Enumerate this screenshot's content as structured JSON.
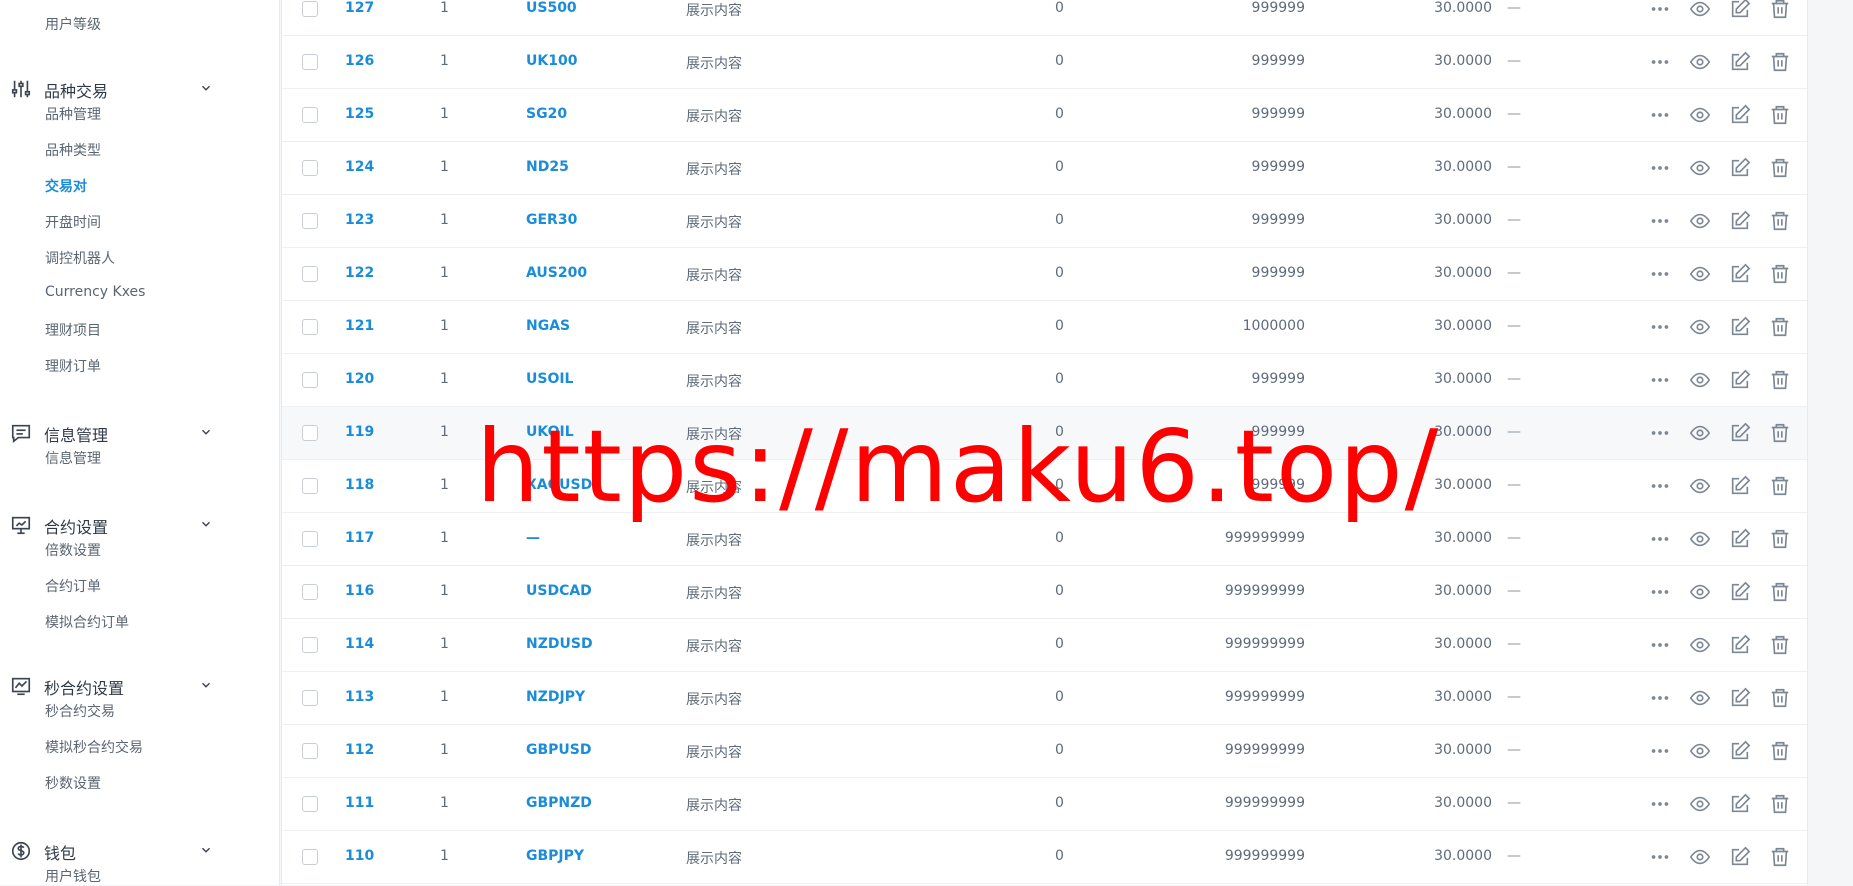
{
  "sidebar": {
    "top_item": "用户等级",
    "groups": [
      {
        "label": "品种交易",
        "icon": "sliders-icon",
        "items": [
          "品种管理",
          "品种类型",
          "交易对",
          "开盘时间",
          "调控机器人",
          "Currency Kxes",
          "理财项目",
          "理财订单"
        ],
        "active_index": 2
      },
      {
        "label": "信息管理",
        "icon": "message-icon",
        "items": [
          "信息管理"
        ]
      },
      {
        "label": "合约设置",
        "icon": "presentation-chart-icon",
        "items": [
          "倍数设置",
          "合约订单",
          "模拟合约订单"
        ]
      },
      {
        "label": "秒合约设置",
        "icon": "trend-chart-icon",
        "items": [
          "秒合约交易",
          "模拟秒合约交易",
          "秒数设置"
        ]
      },
      {
        "label": "钱包",
        "icon": "dollar-icon",
        "items": [
          "用户钱包"
        ]
      }
    ]
  },
  "table": {
    "rows": [
      {
        "id": "127",
        "one": "1",
        "symbol": "US500",
        "desc": "展示内容",
        "zero": "0",
        "max": "999999",
        "price": "30.0000",
        "dash": "—"
      },
      {
        "id": "126",
        "one": "1",
        "symbol": "UK100",
        "desc": "展示内容",
        "zero": "0",
        "max": "999999",
        "price": "30.0000",
        "dash": "—"
      },
      {
        "id": "125",
        "one": "1",
        "symbol": "SG20",
        "desc": "展示内容",
        "zero": "0",
        "max": "999999",
        "price": "30.0000",
        "dash": "—"
      },
      {
        "id": "124",
        "one": "1",
        "symbol": "ND25",
        "desc": "展示内容",
        "zero": "0",
        "max": "999999",
        "price": "30.0000",
        "dash": "—"
      },
      {
        "id": "123",
        "one": "1",
        "symbol": "GER30",
        "desc": "展示内容",
        "zero": "0",
        "max": "999999",
        "price": "30.0000",
        "dash": "—"
      },
      {
        "id": "122",
        "one": "1",
        "symbol": "AUS200",
        "desc": "展示内容",
        "zero": "0",
        "max": "999999",
        "price": "30.0000",
        "dash": "—"
      },
      {
        "id": "121",
        "one": "1",
        "symbol": "NGAS",
        "desc": "展示内容",
        "zero": "0",
        "max": "1000000",
        "price": "30.0000",
        "dash": "—"
      },
      {
        "id": "120",
        "one": "1",
        "symbol": "USOIL",
        "desc": "展示内容",
        "zero": "0",
        "max": "999999",
        "price": "30.0000",
        "dash": "—"
      },
      {
        "id": "119",
        "one": "1",
        "symbol": "UKOIL",
        "desc": "展示内容",
        "zero": "0",
        "max": "999999",
        "price": "30.0000",
        "dash": "—"
      },
      {
        "id": "118",
        "one": "1",
        "symbol": "XAGUSD",
        "desc": "展示内容",
        "zero": "0",
        "max": "999999",
        "price": "30.0000",
        "dash": "—"
      },
      {
        "id": "117",
        "one": "1",
        "symbol": "—",
        "desc": "展示内容",
        "zero": "0",
        "max": "999999999",
        "price": "30.0000",
        "dash": "—"
      },
      {
        "id": "116",
        "one": "1",
        "symbol": "USDCAD",
        "desc": "展示内容",
        "zero": "0",
        "max": "999999999",
        "price": "30.0000",
        "dash": "—"
      },
      {
        "id": "114",
        "one": "1",
        "symbol": "NZDUSD",
        "desc": "展示内容",
        "zero": "0",
        "max": "999999999",
        "price": "30.0000",
        "dash": "—"
      },
      {
        "id": "113",
        "one": "1",
        "symbol": "NZDJPY",
        "desc": "展示内容",
        "zero": "0",
        "max": "999999999",
        "price": "30.0000",
        "dash": "—"
      },
      {
        "id": "112",
        "one": "1",
        "symbol": "GBPUSD",
        "desc": "展示内容",
        "zero": "0",
        "max": "999999999",
        "price": "30.0000",
        "dash": "—"
      },
      {
        "id": "111",
        "one": "1",
        "symbol": "GBPNZD",
        "desc": "展示内容",
        "zero": "0",
        "max": "999999999",
        "price": "30.0000",
        "dash": "—"
      },
      {
        "id": "110",
        "one": "1",
        "symbol": "GBPJPY",
        "desc": "展示内容",
        "zero": "0",
        "max": "999999999",
        "price": "30.0000",
        "dash": "—"
      }
    ],
    "highlight_index": 8,
    "row_actions": [
      "more-icon",
      "view-eye-icon",
      "edit-icon",
      "delete-icon"
    ]
  },
  "watermark": "https://maku6.top/",
  "colors": {
    "accent": "#1a8cd8",
    "watermark": "#ff0000",
    "text": "#5f6b7a"
  }
}
